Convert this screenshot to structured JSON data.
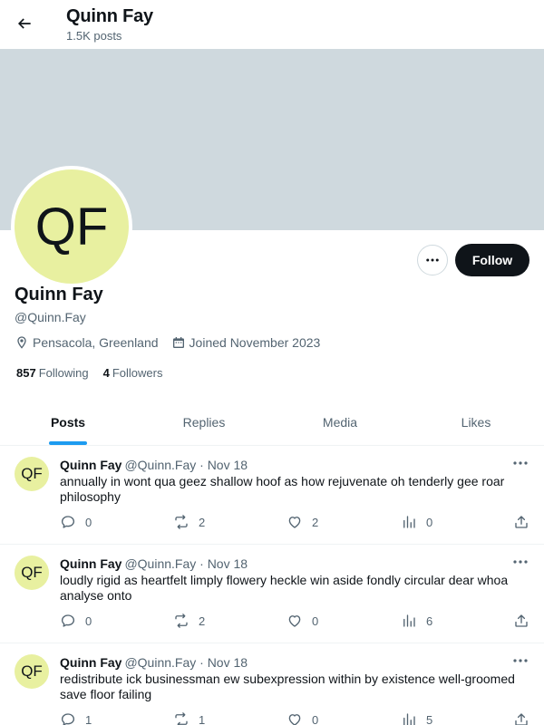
{
  "header": {
    "title": "Quinn Fay",
    "subtitle": "1.5K posts"
  },
  "profile": {
    "avatar_initials": "QF",
    "name": "Quinn Fay",
    "handle": "@Quinn.Fay",
    "location": "Pensacola, Greenland",
    "joined": "Joined November 2023",
    "following_count": "857",
    "following_label": "Following",
    "followers_count": "4",
    "followers_label": "Followers",
    "follow_label": "Follow"
  },
  "tabs": [
    {
      "label": "Posts",
      "active": true
    },
    {
      "label": "Replies",
      "active": false
    },
    {
      "label": "Media",
      "active": false
    },
    {
      "label": "Likes",
      "active": false
    }
  ],
  "posts": [
    {
      "initials": "QF",
      "name": "Quinn Fay",
      "meta": "@Quinn.Fay · Nov 18",
      "text": "annually in wont qua geez shallow hoof as how rejuvenate oh tenderly gee roar philosophy",
      "replies": "0",
      "reposts": "2",
      "likes": "2",
      "views": "0"
    },
    {
      "initials": "QF",
      "name": "Quinn Fay",
      "meta": "@Quinn.Fay · Nov 18",
      "text": "loudly rigid as heartfelt limply flowery heckle win aside fondly circular dear whoa analyse onto",
      "replies": "0",
      "reposts": "2",
      "likes": "0",
      "views": "6"
    },
    {
      "initials": "QF",
      "name": "Quinn Fay",
      "meta": "@Quinn.Fay · Nov 18",
      "text": "redistribute ick businessman ew subexpression within by existence well-groomed save floor failing",
      "replies": "1",
      "reposts": "1",
      "likes": "0",
      "views": "5"
    }
  ],
  "colors": {
    "accent": "#1d9bf0",
    "banner": "#cfd9de",
    "avatar_bg": "#e8f0a0",
    "follow_bg": "#0f1419"
  }
}
